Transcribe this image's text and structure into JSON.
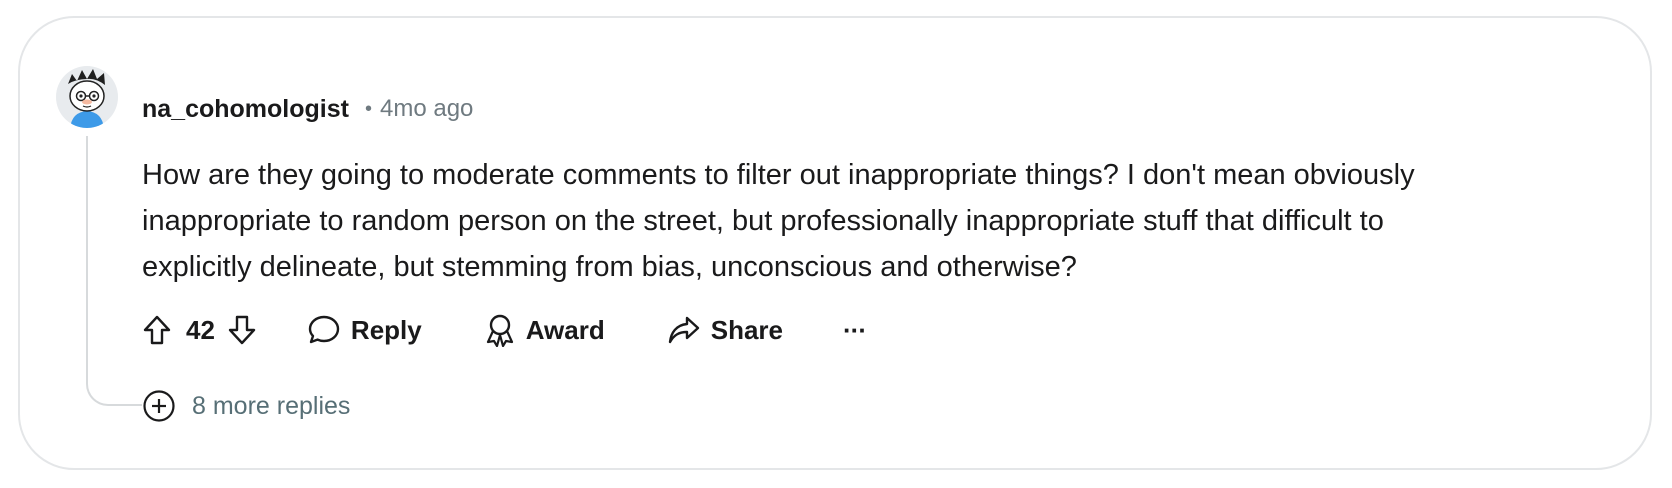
{
  "comment": {
    "username": "na_cohomologist",
    "separator": "•",
    "timestamp": "4mo ago",
    "body_lines": [
      "How are they going to moderate comments to filter out inappropriate things? I don't mean obviously",
      "inappropriate to random person on the street, but professionally inappropriate stuff that difficult to",
      "explicitly delineate, but stemming from bias, unconscious and otherwise?"
    ],
    "avatar_icon": "user-avatar-icon"
  },
  "actions": {
    "upvote_icon": "upvote-arrow-icon",
    "vote_count": "42",
    "downvote_icon": "downvote-arrow-icon",
    "reply_label": "Reply",
    "reply_icon": "speech-bubble-icon",
    "award_label": "Award",
    "award_icon": "award-ribbon-icon",
    "share_label": "Share",
    "share_icon": "share-arrow-icon",
    "more_label": "···"
  },
  "more_replies": {
    "label": "8 more replies",
    "icon": "plus-circle-icon"
  },
  "colors": {
    "text": "#1a1a1b",
    "muted": "#6f7a80",
    "border": "#e4e6e8",
    "thread_line": "#d7dadc"
  }
}
